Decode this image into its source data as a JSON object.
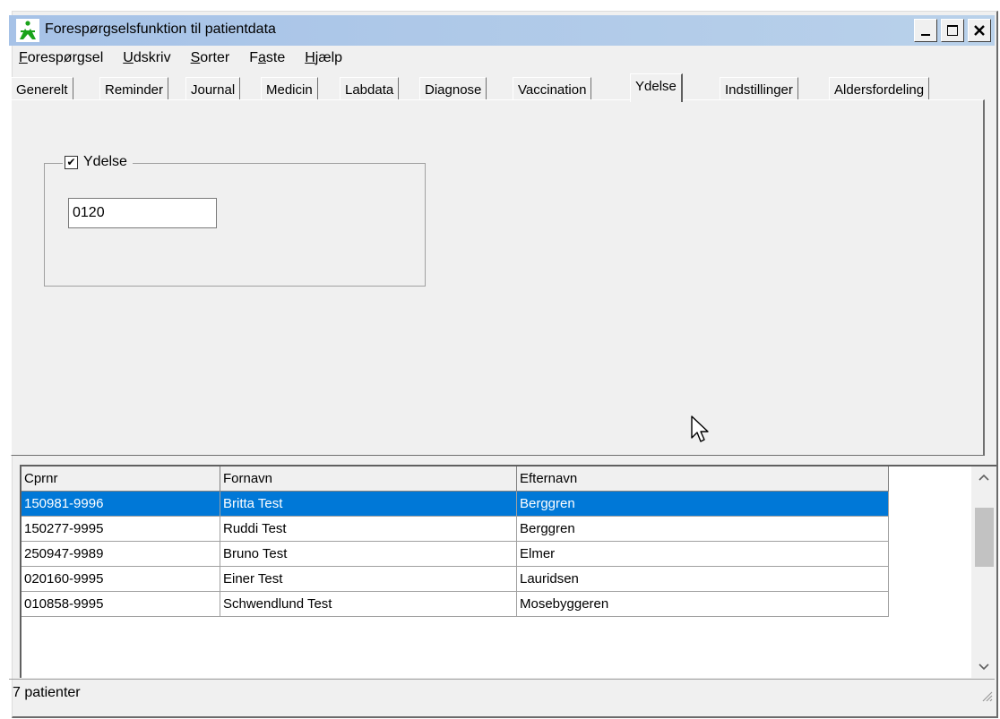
{
  "window": {
    "title": "Forespørgselsfunktion til patientdata",
    "controls": {
      "minimize": "_",
      "maximize": "□",
      "close": "✕"
    }
  },
  "menu": [
    {
      "label": "Forespørgsel",
      "hotkey": "F",
      "rest": "orespørgsel"
    },
    {
      "label": "Udskriv",
      "hotkey": "U",
      "rest": "dskriv"
    },
    {
      "label": "Sorter",
      "hotkey": "S",
      "rest": "orter"
    },
    {
      "label": "Faste",
      "hotkey_prefix": "F",
      "hotkey": "a",
      "rest": "ste"
    },
    {
      "label": "Hjælp",
      "hotkey": "H",
      "rest": "jælp"
    }
  ],
  "tabs": [
    {
      "label": "Generelt"
    },
    {
      "label": "Reminder"
    },
    {
      "label": "Journal"
    },
    {
      "label": "Medicin"
    },
    {
      "label": "Labdata"
    },
    {
      "label": "Diagnose"
    },
    {
      "label": "Vaccination"
    },
    {
      "label": "Ydelse",
      "active": true
    },
    {
      "label": "Indstillinger"
    },
    {
      "label": "Aldersfordeling"
    }
  ],
  "ydelse": {
    "group_label": "Ydelse",
    "checked": true,
    "check_glyph": "✔",
    "code_value": "0120"
  },
  "grid": {
    "columns": [
      "Cprnr",
      "Fornavn",
      "Efternavn"
    ],
    "rows": [
      {
        "cprnr": "150981-9996",
        "fornavn": "Britta Test",
        "efternavn": "Berggren",
        "selected": true
      },
      {
        "cprnr": "150277-9995",
        "fornavn": "Ruddi Test",
        "efternavn": "Berggren"
      },
      {
        "cprnr": "250947-9989",
        "fornavn": "Bruno Test",
        "efternavn": "Elmer"
      },
      {
        "cprnr": "020160-9995",
        "fornavn": "Einer Test",
        "efternavn": "Lauridsen"
      },
      {
        "cprnr": "010858-9995",
        "fornavn": "Schwendlund Test",
        "efternavn": "Mosebyggeren"
      }
    ]
  },
  "status": {
    "text": "7 patienter"
  },
  "colors": {
    "selection": "#0078d7",
    "title_bar": "#b9d1ea",
    "icon_green": "#1aa31a"
  }
}
